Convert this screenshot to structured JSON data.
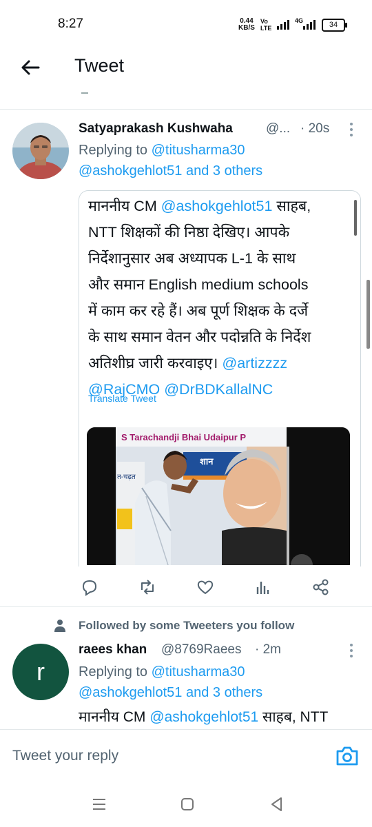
{
  "status_bar": {
    "time": "8:27",
    "net_speed_value": "0.44",
    "net_speed_unit": "KB/S",
    "volte_top": "Vo",
    "volte_bottom": "LTE",
    "network_type": "4G",
    "battery": "34"
  },
  "header": {
    "title": "Tweet"
  },
  "tweet": {
    "author_name": "Satyaprakash Kushwaha",
    "author_handle": "@...",
    "time": "· 20s",
    "replying_label": "Replying to",
    "replying_to": "@titusharma30",
    "replying_more_handle": "@ashokgehlot51",
    "replying_more_rest": "and 3 others",
    "text_lines": [
      {
        "before": "माननीय CM ",
        "link": "@ashokgehlot51",
        "after": " साहब,"
      },
      {
        "before": "NTT शिक्षकों की निष्ठा देखिए। आपके",
        "link": "",
        "after": ""
      },
      {
        "before": "निर्देशानुसार अब अध्यापक L-1 के साथ",
        "link": "",
        "after": ""
      },
      {
        "before": "और समान English medium schools",
        "link": "",
        "after": ""
      },
      {
        "before": "में काम कर रहे हैं। अब पूर्ण शिक्षक के दर्जे",
        "link": "",
        "after": ""
      },
      {
        "before": "के साथ समान वेतन और पदोन्नति के निर्देश",
        "link": "",
        "after": ""
      },
      {
        "before": "अतिशीघ्र जारी करवाइए। ",
        "link": "@artizzzz",
        "after": ""
      },
      {
        "before": "",
        "link": "@RajCMO",
        "after": ""
      },
      {
        "before": " ",
        "link": "@DrBDKallalNC",
        "after": ""
      }
    ],
    "translate_label": "Translate Tweet",
    "media_caption": "S Tarachandji Bhai Udaipur P",
    "media_banner_text": "शान",
    "media_side_text": "त-चढ़त"
  },
  "followed_label": "Followed by some Tweeters you follow",
  "reply_tweet": {
    "avatar_letter": "r",
    "author_name": "raees khan",
    "author_handle": "@8769Raees",
    "time": "· 2m",
    "replying_label": "Replying to",
    "replying_to": "@titusharma30",
    "replying_more_handle": "@ashokgehlot51",
    "replying_more_rest": "and 3 others",
    "text_before": "माननीय CM ",
    "text_link": "@ashokgehlot51",
    "text_after": " साहब, NTT"
  },
  "reply_bar": {
    "placeholder": "Tweet your reply"
  },
  "icons": [
    "back-arrow-icon",
    "more-icon",
    "reply-icon",
    "retweet-icon",
    "like-icon",
    "analytics-icon",
    "share-icon",
    "person-icon",
    "camera-icon",
    "menu-icon",
    "home-icon",
    "back-icon"
  ],
  "colors": {
    "accent": "#1d9bf0",
    "muted": "#536471",
    "text": "#0f1419",
    "avatar_r": "#12543f"
  }
}
